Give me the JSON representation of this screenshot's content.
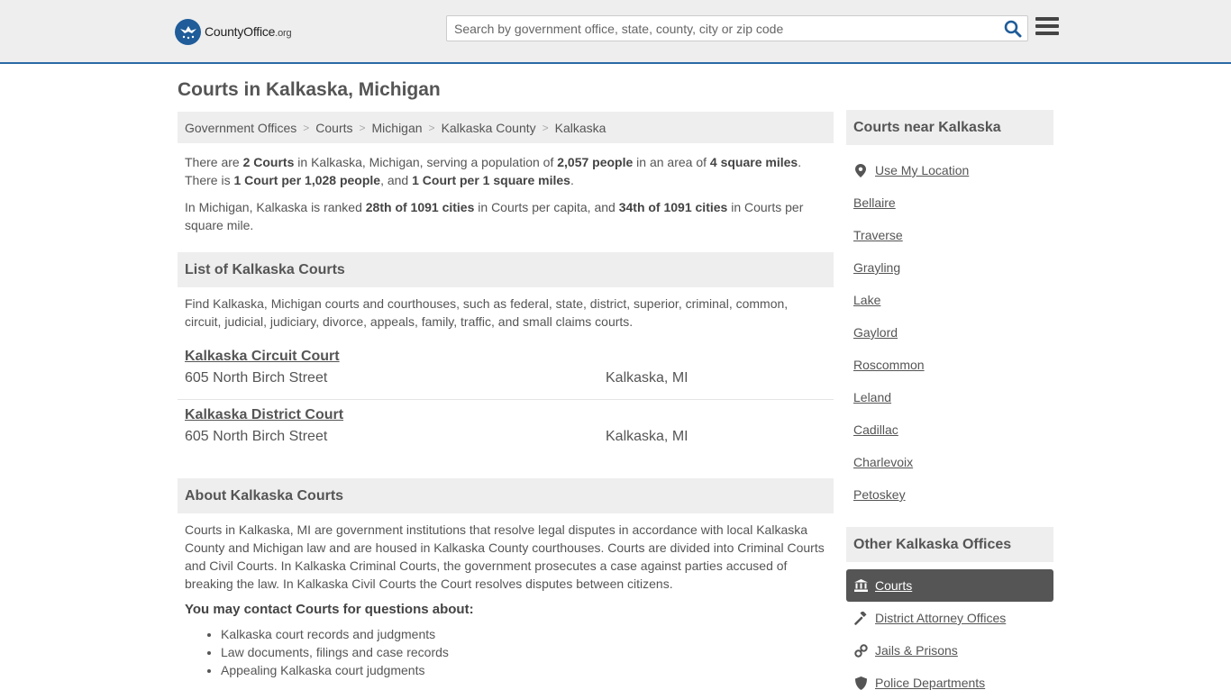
{
  "header": {
    "logo_main": "CountyOffice",
    "logo_tld": ".org",
    "search_placeholder": "Search by government office, state, county, city or zip code"
  },
  "page_title": "Courts in Kalkaska, Michigan",
  "breadcrumb": [
    "Government Offices",
    "Courts",
    "Michigan",
    "Kalkaska County",
    "Kalkaska"
  ],
  "intro": {
    "p1": {
      "t1": "There are ",
      "b1": "2 Courts",
      "t2": " in Kalkaska, Michigan, serving a population of ",
      "b2": "2,057 people",
      "t3": " in an area of ",
      "b3": "4 square miles",
      "t4": ". There is ",
      "b4": "1 Court per 1,028 people",
      "t5": ", and ",
      "b5": "1 Court per 1 square miles",
      "t6": "."
    },
    "p2": {
      "t1": "In Michigan, Kalkaska is ranked ",
      "b1": "28th of 1091 cities",
      "t2": " in Courts per capita, and ",
      "b2": "34th of 1091 cities",
      "t3": " in Courts per square mile."
    }
  },
  "list_section": {
    "heading": "List of Kalkaska Courts",
    "description": "Find Kalkaska, Michigan courts and courthouses, such as federal, state, district, superior, criminal, common, circuit, judicial, judiciary, divorce, appeals, family, traffic, and small claims courts.",
    "courts": [
      {
        "name": "Kalkaska Circuit Court",
        "address": "605 North Birch Street",
        "city": "Kalkaska, MI"
      },
      {
        "name": "Kalkaska District Court",
        "address": "605 North Birch Street",
        "city": "Kalkaska, MI"
      }
    ]
  },
  "about_section": {
    "heading": "About Kalkaska Courts",
    "text": "Courts in Kalkaska, MI are government institutions that resolve legal disputes in accordance with local Kalkaska County and Michigan law and are housed in Kalkaska County courthouses. Courts are divided into Criminal Courts and Civil Courts. In Kalkaska Criminal Courts, the government prosecutes a case against parties accused of breaking the law. In Kalkaska Civil Courts the Court resolves disputes between citizens.",
    "contact_heading": "You may contact Courts for questions about:",
    "topics": [
      "Kalkaska court records and judgments",
      "Law documents, filings and case records",
      "Appealing Kalkaska court judgments"
    ]
  },
  "sidebar": {
    "near_heading": "Courts near Kalkaska",
    "use_location": "Use My Location",
    "nearby": [
      "Bellaire",
      "Traverse",
      "Grayling",
      "Lake",
      "Gaylord",
      "Roscommon",
      "Leland",
      "Cadillac",
      "Charlevoix",
      "Petoskey"
    ],
    "other_heading": "Other Kalkaska Offices",
    "offices": [
      {
        "label": "Courts",
        "icon": "courthouse-icon",
        "active": true
      },
      {
        "label": "District Attorney Offices",
        "icon": "gavel-icon",
        "active": false
      },
      {
        "label": "Jails & Prisons",
        "icon": "handcuffs-icon",
        "active": false
      },
      {
        "label": "Police Departments",
        "icon": "shield-icon",
        "active": false
      }
    ]
  },
  "colors": {
    "header_bg": "#eeeeee",
    "header_border": "#2a6aa6",
    "accent": "#1f5c99",
    "active_bg": "#555555"
  }
}
